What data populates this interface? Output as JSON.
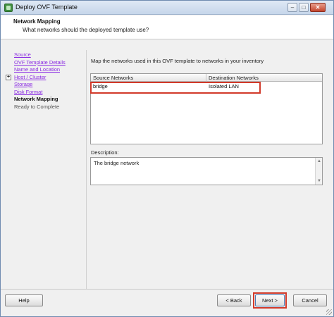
{
  "window": {
    "title": "Deploy OVF Template",
    "controls": {
      "minimize": "–",
      "maximize": "□",
      "close": "✕"
    }
  },
  "header": {
    "title": "Network Mapping",
    "subtitle": "What networks should the deployed template use?"
  },
  "nav": {
    "items": [
      {
        "label": "Source",
        "state": "link"
      },
      {
        "label": "OVF Template Details",
        "state": "link"
      },
      {
        "label": "Name and Location",
        "state": "link"
      },
      {
        "label": "Host / Cluster",
        "state": "link",
        "expander": "⊞"
      },
      {
        "label": "Storage",
        "state": "link"
      },
      {
        "label": "Disk Format",
        "state": "link"
      },
      {
        "label": "Network Mapping",
        "state": "current"
      },
      {
        "label": "Ready to Complete",
        "state": "future"
      }
    ]
  },
  "main": {
    "instruction": "Map the networks used in this OVF template to networks in your inventory",
    "grid": {
      "columns": [
        "Source Networks",
        "Destination Networks"
      ],
      "rows": [
        {
          "source": "bridge",
          "destination": "Isolated LAN"
        }
      ]
    },
    "description_label": "Description:",
    "description_text": "The bridge network"
  },
  "footer": {
    "help": "Help",
    "back": "< Back",
    "next": "Next >",
    "cancel": "Cancel"
  },
  "colors": {
    "highlight": "#d23a2a",
    "visited_link": "#8a2be2"
  },
  "icons": {
    "app": "ovf-deploy-icon",
    "expander": "plus-box-icon",
    "resize": "resize-grip-icon"
  }
}
